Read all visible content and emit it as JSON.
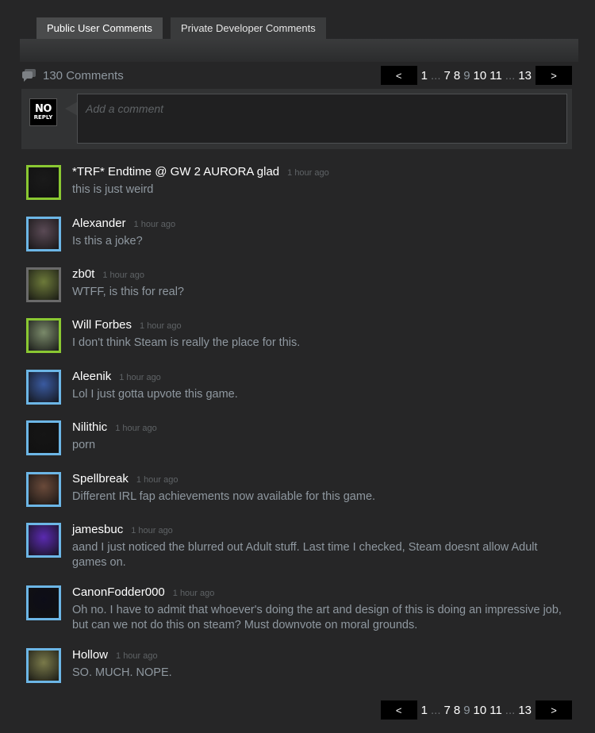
{
  "tabs": [
    {
      "label": "Public User Comments"
    },
    {
      "label": "Private Developer Comments"
    }
  ],
  "comment_count": "130 Comments",
  "pager": {
    "prev": "<",
    "next": ">",
    "pages": [
      "1",
      "...",
      "7",
      "8",
      "9",
      "10",
      "11",
      "...",
      "13"
    ],
    "current": "9"
  },
  "entry": {
    "avatar_line1": "NO",
    "avatar_line2": "REPLY",
    "placeholder": "Add a comment"
  },
  "comments": [
    {
      "author": "*TRF* Endtime @ GW 2 AURORA glad",
      "time": "1 hour ago",
      "text": "this is just weird",
      "status": "ingame",
      "avatar_color": "#1a1a1a"
    },
    {
      "author": "Alexander",
      "time": "1 hour ago",
      "text": "Is this a joke?",
      "status": "online",
      "avatar_color": "#5a4a55"
    },
    {
      "author": "zb0t",
      "time": "1 hour ago",
      "text": "WTFF, is this for real?",
      "status": "offline",
      "avatar_color": "#6d7a3a"
    },
    {
      "author": "Will Forbes",
      "time": "1 hour ago",
      "text": "I don't think Steam is really the place for this.",
      "status": "ingame",
      "avatar_color": "#7a8a6a"
    },
    {
      "author": "Aleenik",
      "time": "1 hour ago",
      "text": "Lol I just gotta upvote this game.",
      "status": "online",
      "avatar_color": "#3a5aa0"
    },
    {
      "author": "Nilithic",
      "time": "1 hour ago",
      "text": "porn",
      "status": "online",
      "avatar_color": "#151515"
    },
    {
      "author": "Spellbreak",
      "time": "1 hour ago",
      "text": "Different IRL fap achievements now available for this game.",
      "status": "online",
      "avatar_color": "#6a4a3a"
    },
    {
      "author": "jamesbuc",
      "time": "1 hour ago",
      "text": "aand I just noticed the blurred out Adult stuff. Last time I checked, Steam doesnt allow Adult games on.",
      "status": "online",
      "avatar_color": "#5a2ab0"
    },
    {
      "author": "CanonFodder000",
      "time": "1 hour ago",
      "text": "Oh no. I have to admit that whoever's doing the art and design of this is doing an impressive job, but can we not do this on steam? Must downvote on moral grounds.",
      "status": "online",
      "avatar_color": "#0d0d18"
    },
    {
      "author": "Hollow",
      "time": "1 hour ago",
      "text": "SO. MUCH. NOPE.",
      "status": "online",
      "avatar_color": "#7a7a4a"
    }
  ]
}
